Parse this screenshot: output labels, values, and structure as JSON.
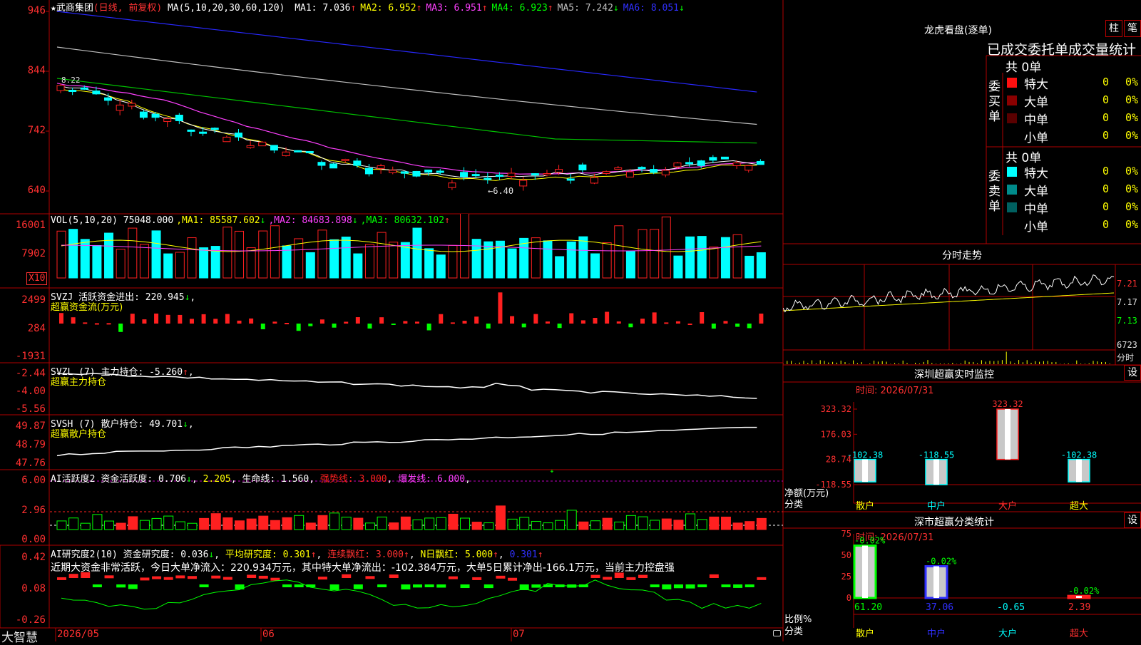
{
  "main": {
    "stock_name": "武商集团",
    "period": "(日线, 前复权)",
    "ma_header": "MA(5,10,20,30,60,120)",
    "ma_values": [
      {
        "label": "MA1:",
        "value": "7.036",
        "arrow": "↑",
        "color": "#ffffff"
      },
      {
        "label": "MA2:",
        "value": "6.952",
        "arrow": "↑",
        "color": "#ffff00"
      },
      {
        "label": "MA3:",
        "value": "6.951",
        "arrow": "↑",
        "color": "#ff40ff"
      },
      {
        "label": "MA4:",
        "value": "6.923",
        "arrow": "↑",
        "color": "#00ff00"
      },
      {
        "label": "MA5:",
        "value": "7.242",
        "arrow": "↓",
        "color": "#c0c0c0"
      },
      {
        "label": "MA6:",
        "value": "8.051",
        "arrow": "↓",
        "color": "#3030ff"
      }
    ],
    "y_labels": [
      "946",
      "844",
      "742",
      "640"
    ],
    "low_annotation": "←6.40",
    "high_annotation": "8.22"
  },
  "vol": {
    "header": "VOL(5,10,20)",
    "value": "75048.000",
    "ma": [
      {
        "label": "MA1:",
        "value": "85587.602",
        "arrow": "↓",
        "color": "#ffff00"
      },
      {
        "label": "MA2:",
        "value": "84683.898",
        "arrow": "↓",
        "color": "#ff40ff"
      },
      {
        "label": "MA3:",
        "value": "80632.102",
        "arrow": "↑",
        "color": "#00ff00"
      }
    ],
    "y_labels": [
      "16001",
      "7902"
    ],
    "unit": "X10"
  },
  "svzj": {
    "name": "SVZJ",
    "label": "活跃资金进出:",
    "value": "220.945",
    "arrow": "↓",
    "sub": "超赢资金流(万元)",
    "y_labels": [
      "2499",
      "284",
      "-1931"
    ]
  },
  "svzl": {
    "name": "SVZL (7)",
    "label": "主力持仓:",
    "value": "-5.260",
    "arrow": "↑",
    "sub": "超赢主力持仓",
    "y_labels": [
      "-2.44",
      "-4.00",
      "-5.56"
    ]
  },
  "svsh": {
    "name": "SVSH (7)",
    "label": "散户持仓:",
    "value": "49.701",
    "arrow": "↓",
    "sub": "超赢散户持仓",
    "y_labels": [
      "49.87",
      "48.79",
      "47.76"
    ]
  },
  "ai_active": {
    "name": "AI活跃度2",
    "label1": "资金活跃度:",
    "v1": "0.706",
    "v1a": "↓",
    "v2": "2.205",
    "label3": "生命线:",
    "v3": "1.560",
    "label4": "强势线:",
    "v4": "3.000",
    "label5": "爆发线:",
    "v5": "6.000",
    "y_labels": [
      "6.00",
      "2.96",
      "0.00"
    ]
  },
  "ai_research": {
    "name": "AI研究度2(10)",
    "label1": "资金研究度:",
    "v1": "0.036",
    "v1a": "↓",
    "label2": "平均研究度:",
    "v2": "0.301",
    "v2a": "↑",
    "label3": "连续飘红:",
    "v3": "3.000",
    "v3a": "↑",
    "label4": "N日飘红:",
    "v4": "5.000",
    "v4a": "↑",
    "v5": "0.301",
    "v5a": "↑",
    "comment": "近期大资金非常活跃，今日大单净流入：220.934万元，其中特大单净流出：-102.384万元，大单5日累计净出-166.1万元，当前主力控盘强",
    "y_labels": [
      "0.42",
      "0.08",
      "-0.26"
    ]
  },
  "x_axis": {
    "labels": [
      "2026/05",
      "06",
      "07"
    ]
  },
  "brand": "大智慧",
  "right": {
    "dragon_title": "龙虎看盘(逐单)",
    "btn_bar": "柱",
    "btn_pen": "笔",
    "stat_title": "已成交委托单成交量统计",
    "buy": {
      "side": "委买单",
      "total": "共 0单",
      "rows": [
        {
          "name": "特大",
          "v1": "0",
          "v2": "0%",
          "color": "#ff1010"
        },
        {
          "name": "大单",
          "v1": "0",
          "v2": "0%",
          "color": "#8b0000"
        },
        {
          "name": "中单",
          "v1": "0",
          "v2": "0%",
          "color": "#5a0000"
        },
        {
          "name": "小单",
          "v1": "0",
          "v2": "0%",
          "color": "#000000"
        }
      ]
    },
    "sell": {
      "side": "委卖单",
      "total": "共 0单",
      "rows": [
        {
          "name": "特大",
          "v1": "0",
          "v2": "0%",
          "color": "#00ffff"
        },
        {
          "name": "大单",
          "v1": "0",
          "v2": "0%",
          "color": "#008b8b"
        },
        {
          "name": "中单",
          "v1": "0",
          "v2": "0%",
          "color": "#006060"
        },
        {
          "name": "小单",
          "v1": "0",
          "v2": "0%",
          "color": "#000000"
        }
      ]
    },
    "intraday_title": "分时走势",
    "intraday_y": [
      "7.21",
      "7.17",
      "7.13"
    ],
    "intraday_vol": "6723",
    "intraday_unit": "分时",
    "monitor_title": "深圳超赢实时监控",
    "monitor_btn": "设",
    "monitor_time": "时间: 2026/07/31",
    "monitor_y": [
      "323.32",
      "176.03",
      "28.74",
      "-118.55"
    ],
    "monitor_ylabel": "净额(万元)",
    "monitor_xlabel": "分类",
    "classify_title": "深市超赢分类统计",
    "classify_btn": "设",
    "classify_time": "时间: 2026/07/31",
    "classify_y": [
      "75",
      "50",
      "25",
      "0"
    ],
    "classify_ylabel": "比例%",
    "classify_xlabel": "分类"
  },
  "chart_data": [
    {
      "type": "bar",
      "title": "深圳超赢实时监控",
      "ylabel": "净额(万元)",
      "categories": [
        "散户",
        "中户",
        "大户",
        "超大"
      ],
      "values": [
        -102.38,
        -118.55,
        323.32,
        -102.38
      ],
      "ylim": [
        -118.55,
        323.32
      ]
    },
    {
      "type": "bar",
      "title": "深市超赢分类统计",
      "ylabel": "比例%",
      "categories": [
        "散户",
        "中户",
        "大户",
        "超大"
      ],
      "bar_values": [
        61.2,
        37.06,
        -0.65,
        2.39
      ],
      "top_labels": [
        "-0.02%",
        "-0.02%",
        "",
        "-0.02%"
      ],
      "ylim": [
        0,
        75
      ]
    }
  ]
}
